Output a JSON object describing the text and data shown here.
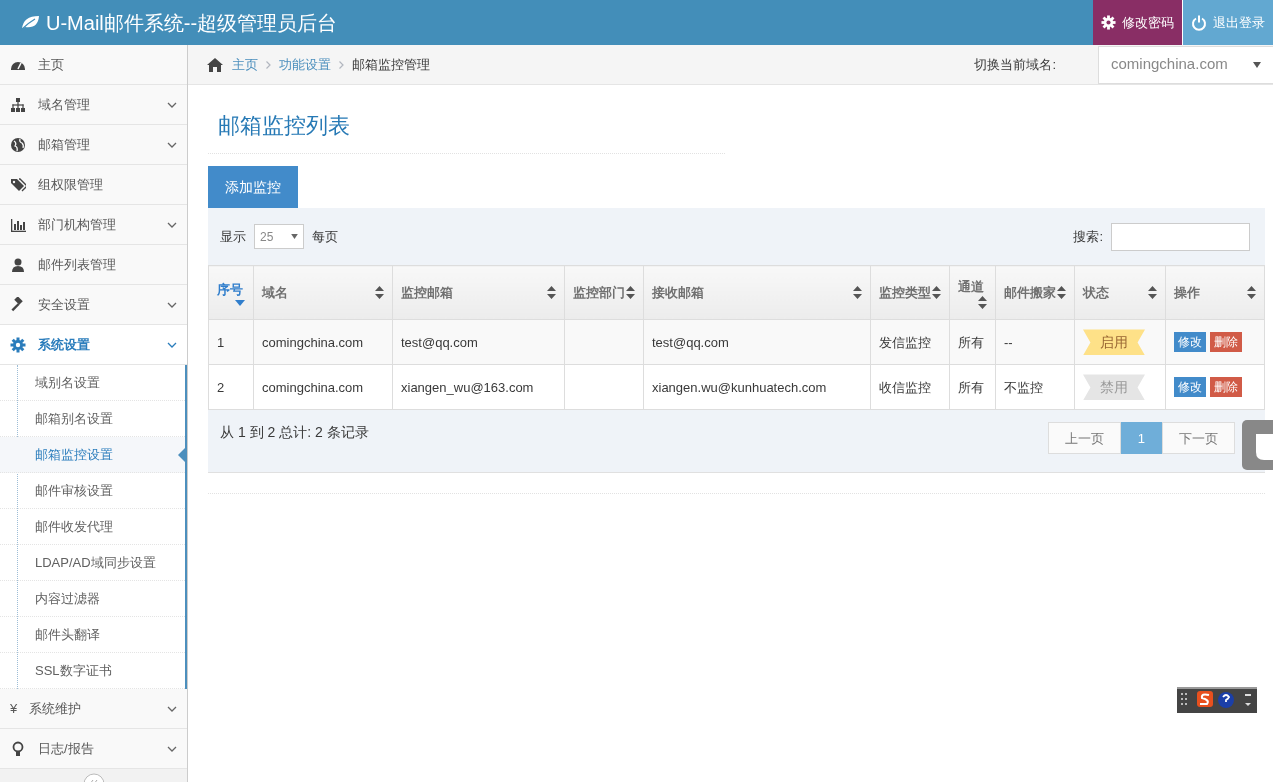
{
  "header": {
    "title": "U-Mail邮件系统--超级管理员后台",
    "buttons": [
      {
        "label": "修改密码",
        "kind": "password"
      },
      {
        "label": "退出登录",
        "kind": "logout"
      }
    ]
  },
  "sidebar": {
    "items": [
      {
        "label": "主页",
        "kind": "link"
      },
      {
        "label": "域名管理",
        "kind": "group",
        "expanded": false
      },
      {
        "label": "邮箱管理",
        "kind": "group",
        "expanded": false
      },
      {
        "label": "组权限管理",
        "kind": "link"
      },
      {
        "label": "部门机构管理",
        "kind": "group",
        "expanded": false
      },
      {
        "label": "邮件列表管理",
        "kind": "link"
      },
      {
        "label": "安全设置",
        "kind": "group",
        "expanded": false
      },
      {
        "label": "系统设置",
        "kind": "group",
        "expanded": true,
        "children": [
          {
            "label": "域别名设置",
            "selected": false
          },
          {
            "label": "邮箱别名设置",
            "selected": false
          },
          {
            "label": "邮箱监控设置",
            "selected": true
          },
          {
            "label": "邮件审核设置",
            "selected": false
          },
          {
            "label": "邮件收发代理",
            "selected": false
          },
          {
            "label": "LDAP/AD域同步设置",
            "selected": false
          },
          {
            "label": "内容过滤器",
            "selected": false
          },
          {
            "label": "邮件头翻译",
            "selected": false
          },
          {
            "label": "SSL数字证书",
            "selected": false
          }
        ]
      },
      {
        "label": "系统维护",
        "icon_char": "¥",
        "kind": "group",
        "expanded": false
      },
      {
        "label": "日志/报告",
        "kind": "group",
        "expanded": false
      }
    ]
  },
  "breadcrumb": {
    "items": [
      {
        "label": "主页",
        "kind": "home"
      },
      {
        "label": "功能设置",
        "kind": "link"
      },
      {
        "label": "邮箱监控管理",
        "kind": "current"
      }
    ],
    "domain_switch": {
      "label": "切换当前域名:",
      "value": "comingchina.com"
    }
  },
  "page_title": "邮箱监控列表",
  "add_button": "添加监控",
  "table": {
    "length_label": "显示",
    "length_value": "25",
    "per_page_label": "每页",
    "search_label": "搜索:",
    "columns": [
      {
        "label": "序号",
        "sorted": true
      },
      {
        "label": "域名",
        "sorted": false
      },
      {
        "label": "监控邮箱",
        "sorted": false
      },
      {
        "label": "监控部门",
        "sorted": false
      },
      {
        "label": "接收邮箱",
        "sorted": false
      },
      {
        "label": "监控类型",
        "sorted": false
      },
      {
        "label": "通道",
        "sorted": false
      },
      {
        "label": "邮件搬家",
        "sorted": false
      },
      {
        "label": "状态",
        "sorted": false
      },
      {
        "label": "操作",
        "sorted": false
      }
    ],
    "rows": [
      {
        "cells": [
          "1",
          "comingchina.com",
          "test@qq.com",
          "",
          "test@qq.com",
          "发信监控",
          "所有",
          "--"
        ],
        "status": {
          "label": "启用",
          "enabled": true
        },
        "actions": [
          {
            "label": "修改",
            "kind": "edit"
          },
          {
            "label": "删除",
            "kind": "delete"
          }
        ]
      },
      {
        "cells": [
          "2",
          "comingchina.com",
          "xiangen_wu@163.com",
          "",
          "xiangen.wu@kunhuatech.com",
          "收信监控",
          "所有",
          "不监控"
        ],
        "status": {
          "label": "禁用",
          "enabled": false
        },
        "actions": [
          {
            "label": "修改",
            "kind": "edit"
          },
          {
            "label": "删除",
            "kind": "delete"
          }
        ]
      }
    ],
    "info": "从 1 到 2 总计: 2 条记录",
    "pagination": {
      "prev": "上一页",
      "pages": [
        {
          "label": "1",
          "selected": true
        }
      ],
      "next": "下一页"
    }
  }
}
